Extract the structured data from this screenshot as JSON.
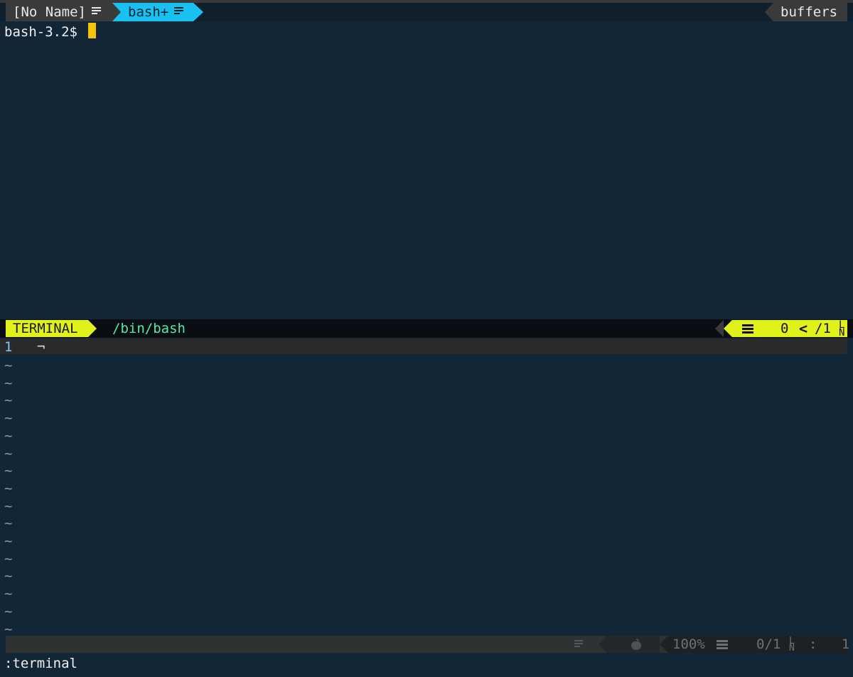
{
  "tabline": {
    "tabs": [
      {
        "label": "[No Name]",
        "icon": "document-lines-icon",
        "active": false
      },
      {
        "label": "bash+",
        "icon": "document-lines-icon",
        "active": true
      }
    ],
    "buffers_label": "buffers"
  },
  "terminal": {
    "prompt": "bash-3.2$ "
  },
  "status_terminal": {
    "mode": "TERMINAL",
    "path": "/bin/bash",
    "position": "0",
    "total": "/1",
    "icons": [
      "lines-icon",
      "chevron-left-icon",
      "line-number-icon"
    ]
  },
  "lower_buffer": {
    "line_number": "1",
    "eol_mark": "¬",
    "tilde": "~"
  },
  "status_buffer": {
    "percent": "100%",
    "position": "0/1",
    "column_sep": ":",
    "column": "1",
    "icons": [
      "document-lines-icon",
      "apple-icon",
      "lines-icon",
      "line-number-icon"
    ]
  },
  "command_line": ":terminal",
  "colors": {
    "background": "#132636",
    "tab_active": "#18c1f2",
    "mode_accent": "#e0f21a",
    "path_text": "#57e6b1",
    "cursor": "#f2c40a"
  }
}
